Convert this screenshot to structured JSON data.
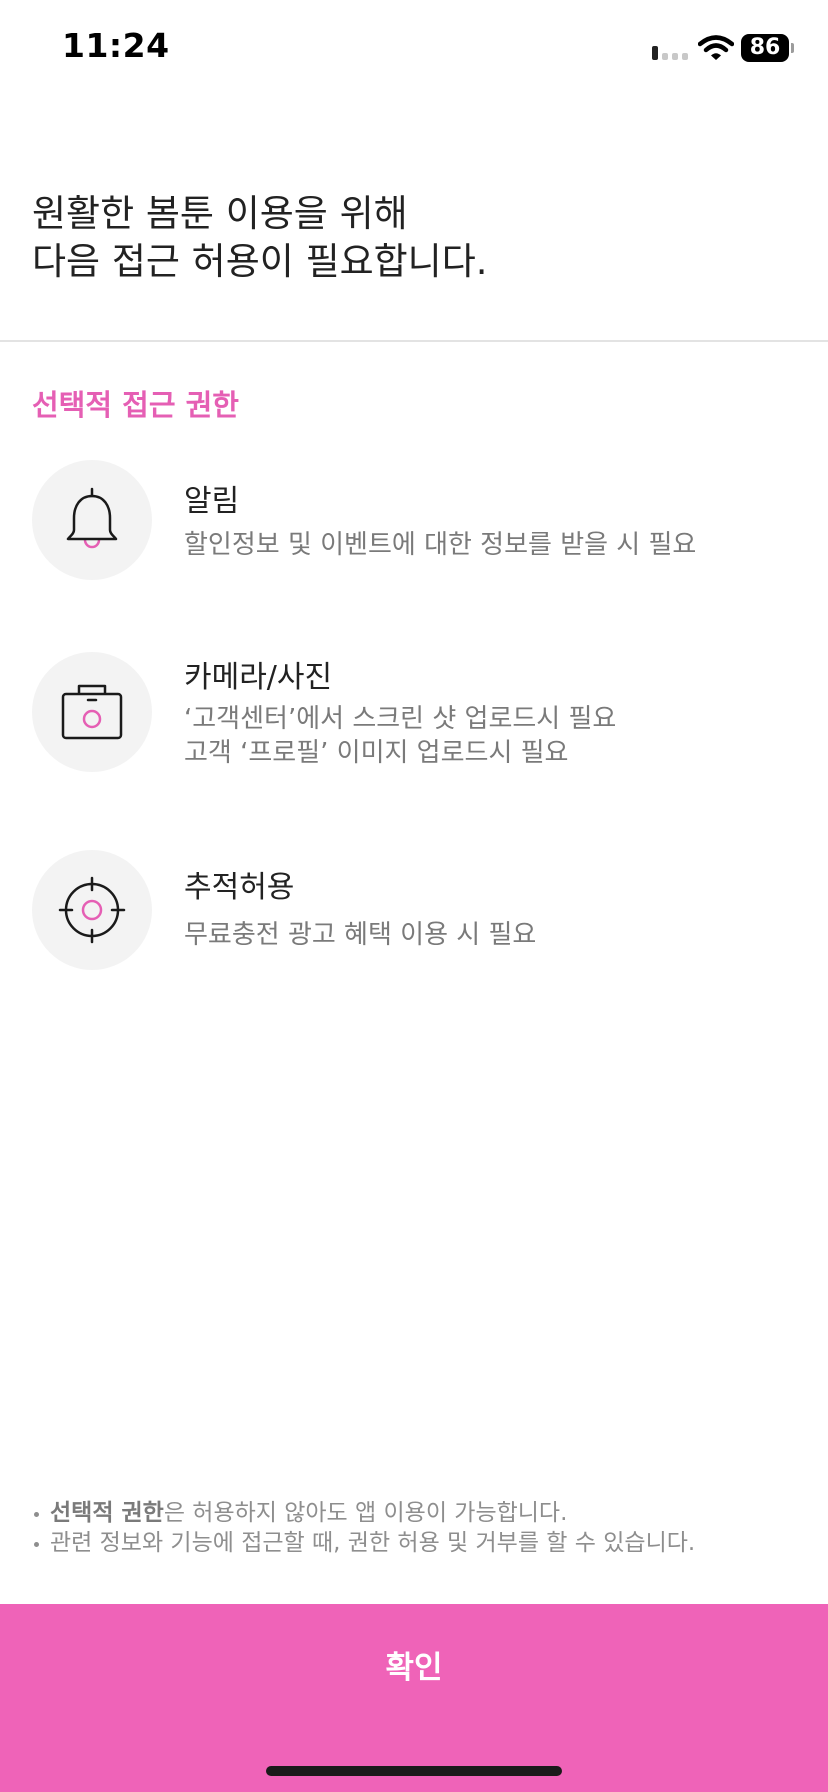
{
  "status_bar": {
    "time": "11:24",
    "battery_level": "86",
    "signal_bars": 1,
    "signal_icon": "cellular-signal-icon",
    "wifi_icon": "wifi-icon"
  },
  "header": {
    "title": "원활한 봄툰 이용을 위해\n다음 접근 허용이 필요합니다."
  },
  "section": {
    "title": "선택적 접근 권한"
  },
  "permissions": [
    {
      "icon": "bell-icon",
      "title": "알림",
      "description": "할인정보 및 이벤트에 대한 정보를 받을 시 필요"
    },
    {
      "icon": "camera-icon",
      "title": "카메라/사진",
      "description": "‘고객센터’에서 스크린 샷 업로드시 필요\n고객 ‘프로필’ 이미지 업로드시 필요"
    },
    {
      "icon": "crosshair-icon",
      "title": "추적허용",
      "description": "무료충전 광고 혜택 이용 시 필요"
    }
  ],
  "notes": [
    {
      "bold": "선택적 권한",
      "text": "은 허용하지 않아도 앱 이용이 가능합니다."
    },
    {
      "bold": "",
      "text": "관련 정보와 기능에 접근할 때, 권한 허용 및 거부를 할 수 있습니다."
    }
  ],
  "confirm_button": {
    "label": "확인"
  },
  "colors": {
    "accent": "#e55fb4",
    "button_background": "#ef63b8",
    "icon_circle": "#f3f3f3",
    "divider": "#e3e3e3"
  }
}
